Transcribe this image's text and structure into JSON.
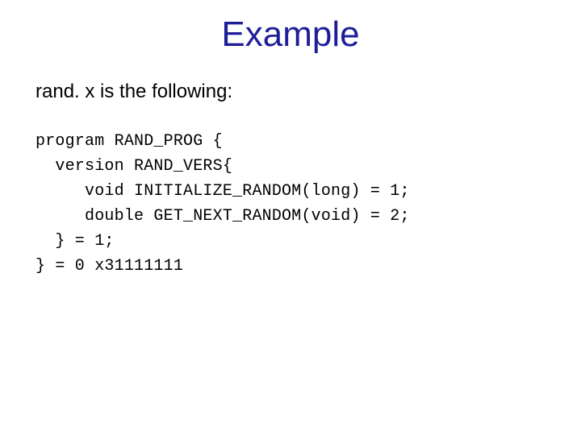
{
  "title": "Example",
  "intro": "rand. x is the following:",
  "code": "program RAND_PROG {\n  version RAND_VERS{\n     void INITIALIZE_RANDOM(long) = 1;\n     double GET_NEXT_RANDOM(void) = 2;\n  } = 1;\n} = 0 x31111111"
}
